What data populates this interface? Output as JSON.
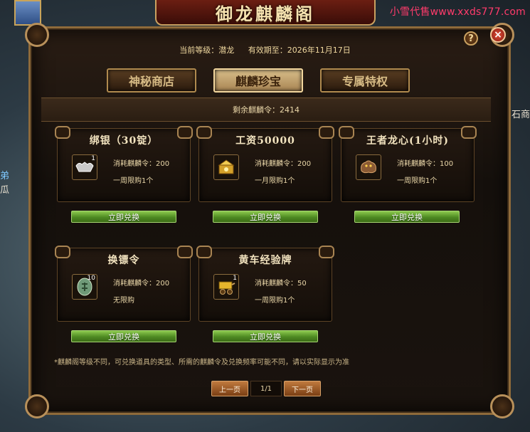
{
  "window": {
    "title": "御龙麒麟阁",
    "watermark": "小雪代售www.xxds777.com"
  },
  "background": {
    "left_texts": [
      "弟",
      "瓜"
    ],
    "right_texts": [
      "石商"
    ]
  },
  "status": {
    "level_label": "当前等级：潜龙",
    "expiry_label": "有效期至：2026年11月17日"
  },
  "tabs": [
    {
      "label": "神秘商店",
      "active": false
    },
    {
      "label": "麒麟珍宝",
      "active": true
    },
    {
      "label": "专属特权",
      "active": false
    }
  ],
  "remaining": "剩余麒麟令：2414",
  "items": [
    {
      "name": "绑银（30锭）",
      "icon": "silver-ingot-icon",
      "qty": "1",
      "cost_label": "消耗麒麟令：",
      "cost": "200",
      "limit": "一周限购1个",
      "button": "立即兑换"
    },
    {
      "name": "工资50000",
      "icon": "wage-chest-icon",
      "qty": "",
      "cost_label": "消耗麒麟令：",
      "cost": "200",
      "limit": "一月限购1个",
      "button": "立即兑换"
    },
    {
      "name": "王者龙心(1小时)",
      "icon": "dragon-heart-icon",
      "qty": "",
      "cost_label": "消耗麒麟令：",
      "cost": "100",
      "limit": "一周限购1个",
      "button": "立即兑换"
    },
    {
      "name": "换镖令",
      "icon": "escort-token-icon",
      "qty": "10",
      "cost_label": "消耗麒麟令：",
      "cost": "200",
      "limit": "无限购",
      "button": "立即兑换"
    },
    {
      "name": "黄车经验牌",
      "icon": "yellow-cart-icon",
      "qty": "1",
      "cost_label": "消耗麒麟令：",
      "cost": "50",
      "limit": "一周限购1个",
      "button": "立即兑换"
    }
  ],
  "note": "*麒麟阁等级不同，可兑换道具的类型、所需的麒麟令及兑换频率可能不同，请以实际显示为准",
  "pager": {
    "prev": "上一页",
    "page": "1/1",
    "next": "下一页"
  },
  "buttons": {
    "help": "?",
    "close": "×"
  }
}
